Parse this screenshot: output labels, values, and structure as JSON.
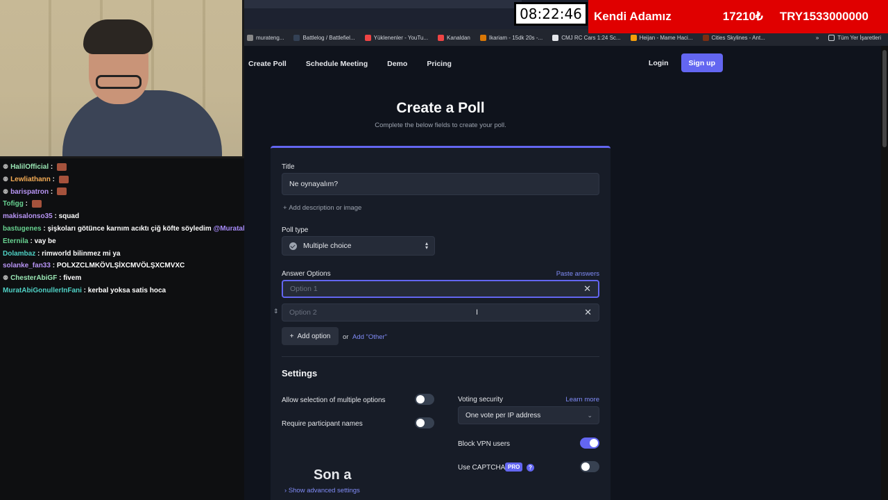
{
  "overlay": {
    "clock": "08:22:46",
    "ticker": [
      "Kendi Adamız",
      "17210₺",
      "TRY1533000000"
    ]
  },
  "chat": [
    {
      "user": "HalilOfficial",
      "color": "#9ae6b4",
      "badge": true,
      "msg": "",
      "emote": true
    },
    {
      "user": "Lewliathann",
      "color": "#f6ad55",
      "badge": true,
      "msg": "",
      "emote": true
    },
    {
      "user": "barispatron",
      "color": "#b794f4",
      "badge": true,
      "msg": "",
      "emote": true
    },
    {
      "user": "Tofigg",
      "color": "#68d391",
      "badge": false,
      "msg": "",
      "emote": true
    },
    {
      "user": "makisalonso35",
      "color": "#b794f4",
      "badge": false,
      "msg": "squad",
      "emote": false
    },
    {
      "user": "bastugenes",
      "color": "#68d391",
      "badge": false,
      "msg": "şişkoları götünce karnım acıktı çiğ köfte söyledim",
      "mention": "@Muratabigf",
      "emote": false
    },
    {
      "user": "Eternila",
      "color": "#68d391",
      "badge": false,
      "msg": "vay be",
      "emote": false
    },
    {
      "user": "Dolambaz",
      "color": "#4fd1c5",
      "badge": false,
      "msg": "rimworld bilinmez mi ya",
      "emote": false
    },
    {
      "user": "solanke_fan33",
      "color": "#b794f4",
      "badge": false,
      "msg": "POLXZCLMKÖVLŞİXCMVÖLŞXCMVXC",
      "emote": false
    },
    {
      "user": "ChesterAbiGF",
      "color": "#9ae6b4",
      "badge": true,
      "msg": "fivem",
      "emote": false
    },
    {
      "user": "MuratAbiGonullerInFani",
      "color": "#4fd1c5",
      "badge": false,
      "msg": "kerbal yoksa satis hoca",
      "emote": false
    }
  ],
  "bookmarks": [
    {
      "label": "murateng...",
      "color": "#888"
    },
    {
      "label": "Battlelog / Battlefiel...",
      "color": "#334155"
    },
    {
      "label": "Yüklenenler - YouTu...",
      "color": "#ef4444"
    },
    {
      "label": "Kanaldan",
      "color": "#ef4444"
    },
    {
      "label": "Ikariam - 15dk 20s -...",
      "color": "#d97706"
    },
    {
      "label": "CMJ RC Cars 1:24 Sc...",
      "color": "#e5e7eb"
    },
    {
      "label": "Heijan - Mame Haci...",
      "color": "#f59e0b"
    },
    {
      "label": "Cities Skylines - Ant...",
      "color": "#7c2d12"
    }
  ],
  "bookmarks_right": {
    "more": "»",
    "all": "Tüm Yer İşaretleri"
  },
  "nav": {
    "links": [
      "Create Poll",
      "Schedule Meeting",
      "Demo",
      "Pricing"
    ],
    "login": "Login",
    "signup": "Sign up"
  },
  "page": {
    "title": "Create a Poll",
    "subtitle": "Complete the below fields to create your poll."
  },
  "form": {
    "title_label": "Title",
    "title_value": "Ne oynayalım?",
    "add_description": "Add description or image",
    "poll_type_label": "Poll type",
    "poll_type_value": "Multiple choice",
    "answer_options_label": "Answer Options",
    "paste_answers": "Paste answers",
    "options": [
      {
        "placeholder": "Option 1",
        "focused": true
      },
      {
        "placeholder": "Option 2",
        "focused": false
      }
    ],
    "add_option": "Add option",
    "or": "or",
    "add_other": "Add \"Other\""
  },
  "settings": {
    "title": "Settings",
    "allow_multiple": {
      "label": "Allow selection of multiple options",
      "on": false
    },
    "require_names": {
      "label": "Require participant names",
      "on": false
    },
    "voting_security_label": "Voting security",
    "learn_more": "Learn more",
    "voting_security_value": "One vote per IP address",
    "block_vpn": {
      "label": "Block VPN users",
      "on": true
    },
    "captcha": {
      "label": "Use CAPTCHA",
      "badge": "PRO",
      "help": "?",
      "on": false
    },
    "show_advanced": "Show advanced settings"
  },
  "stream_text": "Son a"
}
